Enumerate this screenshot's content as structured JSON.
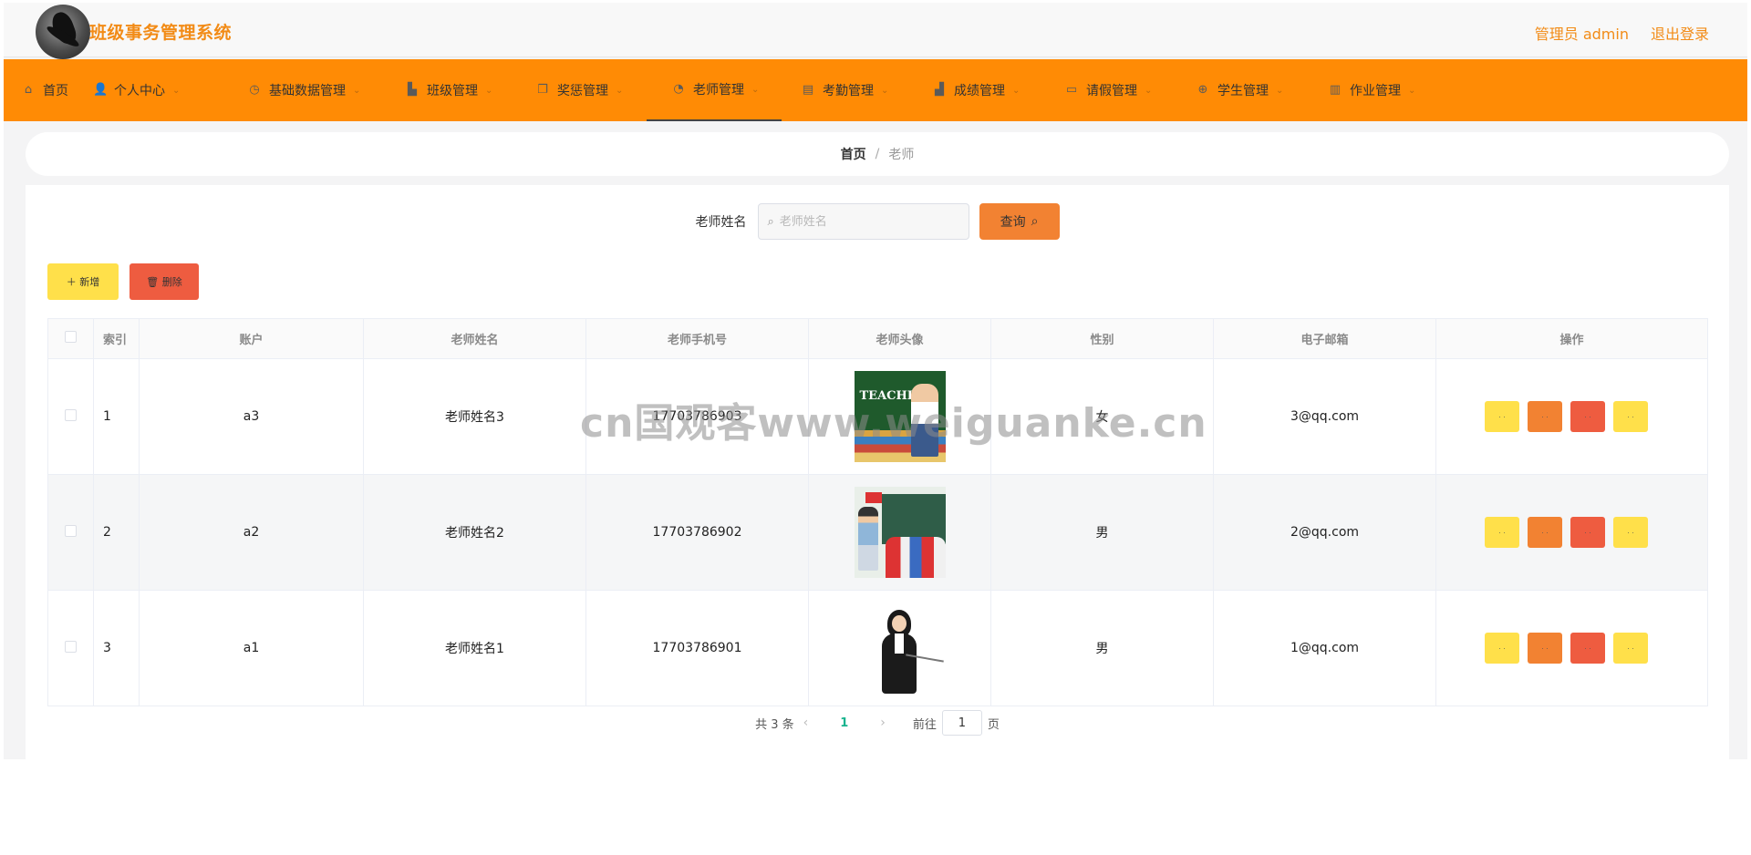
{
  "header": {
    "title": "班级事务管理系统",
    "user_label": "管理员 admin",
    "logout_label": "退出登录"
  },
  "nav": {
    "items": [
      {
        "label": "首页",
        "icon": "home-icon"
      },
      {
        "label": "个人中心",
        "icon": "user-icon"
      },
      {
        "label": "基础数据管理",
        "icon": "dashboard-icon"
      },
      {
        "label": "班级管理",
        "icon": "building-icon"
      },
      {
        "label": "奖惩管理",
        "icon": "copy-icon"
      },
      {
        "label": "老师管理",
        "icon": "clock-icon"
      },
      {
        "label": "考勤管理",
        "icon": "clipboard-icon"
      },
      {
        "label": "成绩管理",
        "icon": "chart-icon"
      },
      {
        "label": "请假管理",
        "icon": "monitor-icon"
      },
      {
        "label": "学生管理",
        "icon": "target-icon"
      },
      {
        "label": "作业管理",
        "icon": "bar-chart-icon"
      }
    ],
    "active_index": 5
  },
  "breadcrumb": {
    "home": "首页",
    "separator": "/",
    "current": "老师"
  },
  "search": {
    "label": "老师姓名",
    "placeholder": "老师姓名",
    "value": "",
    "button_label": "查询"
  },
  "actions": {
    "add_label": "＋ 新增",
    "delete_label": "🗑 删除"
  },
  "table": {
    "columns": [
      "索引",
      "账户",
      "老师姓名",
      "老师手机号",
      "老师头像",
      "性别",
      "电子邮箱",
      "操作"
    ],
    "rows": [
      {
        "index": "1",
        "account": "a3",
        "name": "老师姓名3",
        "phone": "17703786903",
        "gender": "女",
        "email": "3@qq.com"
      },
      {
        "index": "2",
        "account": "a2",
        "name": "老师姓名2",
        "phone": "17703786902",
        "gender": "男",
        "email": "2@qq.com"
      },
      {
        "index": "3",
        "account": "a1",
        "name": "老师姓名1",
        "phone": "17703786901",
        "gender": "男",
        "email": "1@qq.com"
      }
    ],
    "avatar1_text": "TEACHER'S"
  },
  "pagination": {
    "total": "共 3 条",
    "current_page": "1",
    "goto_prefix": "前往",
    "goto_value": "1",
    "goto_suffix": "页"
  },
  "watermark": "cn国观客www.weiguanke.cn",
  "colors": {
    "brand": "#ff8b05",
    "title": "#f28b16",
    "add": "#ffe04a",
    "delete": "#ee5c40",
    "search": "#f28232",
    "page_active": "#19b38e"
  }
}
